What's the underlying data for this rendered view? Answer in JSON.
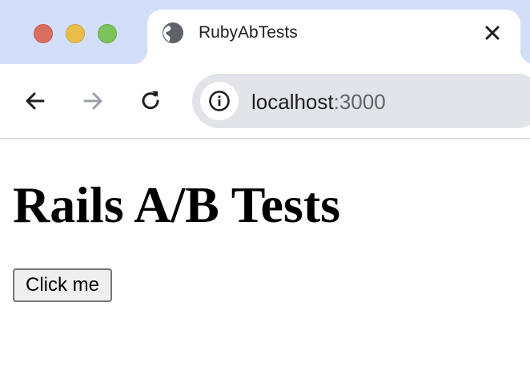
{
  "browser": {
    "tab": {
      "title": "RubyAbTests",
      "favicon": "globe-icon",
      "close_icon": "close-icon"
    },
    "toolbar": {
      "back_icon": "arrow-left-icon",
      "forward_icon": "arrow-right-icon",
      "reload_icon": "reload-icon",
      "site_info_icon": "info-icon"
    },
    "address": {
      "host": "localhost",
      "port": ":3000"
    },
    "colors": {
      "tabstrip": "#d3def8",
      "omnibox": "#e2e4ea",
      "close": "#db6f5f",
      "minimize": "#e8bd4a",
      "maximize": "#7cc35b"
    }
  },
  "page": {
    "heading": "Rails A/B Tests",
    "button_label": "Click me"
  }
}
